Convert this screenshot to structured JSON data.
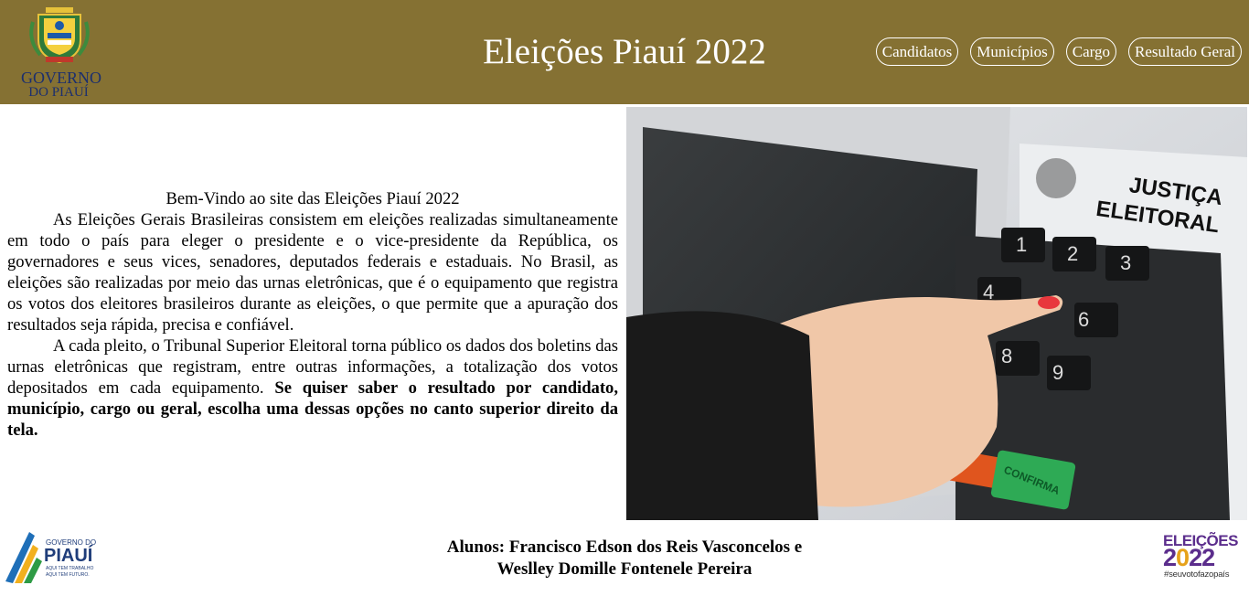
{
  "header": {
    "title": "Eleições Piauí 2022",
    "logo_text_line1": "GOVERNO",
    "logo_text_line2": "DO PIAUÍ",
    "background_color": "#857133",
    "nav": [
      {
        "label": "Candidatos"
      },
      {
        "label": "Municípios"
      },
      {
        "label": "Cargo"
      },
      {
        "label": "Resultado Geral"
      }
    ]
  },
  "intro": {
    "title": "Bem-Vindo ao site das Eleições Piauí 2022",
    "paragraph1": "As Eleições Gerais Brasileiras consistem em eleições realizadas simultaneamente em todo o país para eleger o presidente e o vice-presidente da República, os governadores e seus vices, senadores, deputados federais e estaduais. No Brasil, as eleições são realizadas por meio das urnas eletrônicas, que é o equipamento que registra os votos dos eleitores brasileiros durante as eleições, o que permite que a apuração dos resultados seja rápida, precisa e confiável.",
    "paragraph2": "A cada pleito, o Tribunal Superior Eleitoral torna público os dados dos boletins das urnas eletrônicas que registram, entre outras informações, a totalização dos votos depositados em cada equipamento.",
    "paragraph2_bold": "Se quiser saber o resultado por candidato, município, cargo ou geral, escolha uma dessas opções no canto superior direito da tela."
  },
  "photo": {
    "label_line1": "JUSTIÇA",
    "label_line2": "ELEITORAL",
    "keys": [
      "1",
      "2",
      "3",
      "4",
      "6",
      "8",
      "9"
    ],
    "confirm_label": "CONFIRMA"
  },
  "footer": {
    "credits_line1": "Alunos: Francisco Edson dos Reis Vasconcelos e",
    "credits_line2": "Weslley Domille Fontenele Pereira",
    "gov_logo_small": "GOVERNO DO",
    "gov_logo_big": "PIAUÍ",
    "gov_logo_tag1": "AQUI TEM TRABALHO",
    "gov_logo_tag2": "AQUI TEM FUTURO.",
    "election_logo_title": "ELEIÇÕES",
    "election_logo_year_a": "2",
    "election_logo_year_b": "0",
    "election_logo_year_c": "22",
    "election_logo_tag": "#seuvotofazopaís"
  }
}
